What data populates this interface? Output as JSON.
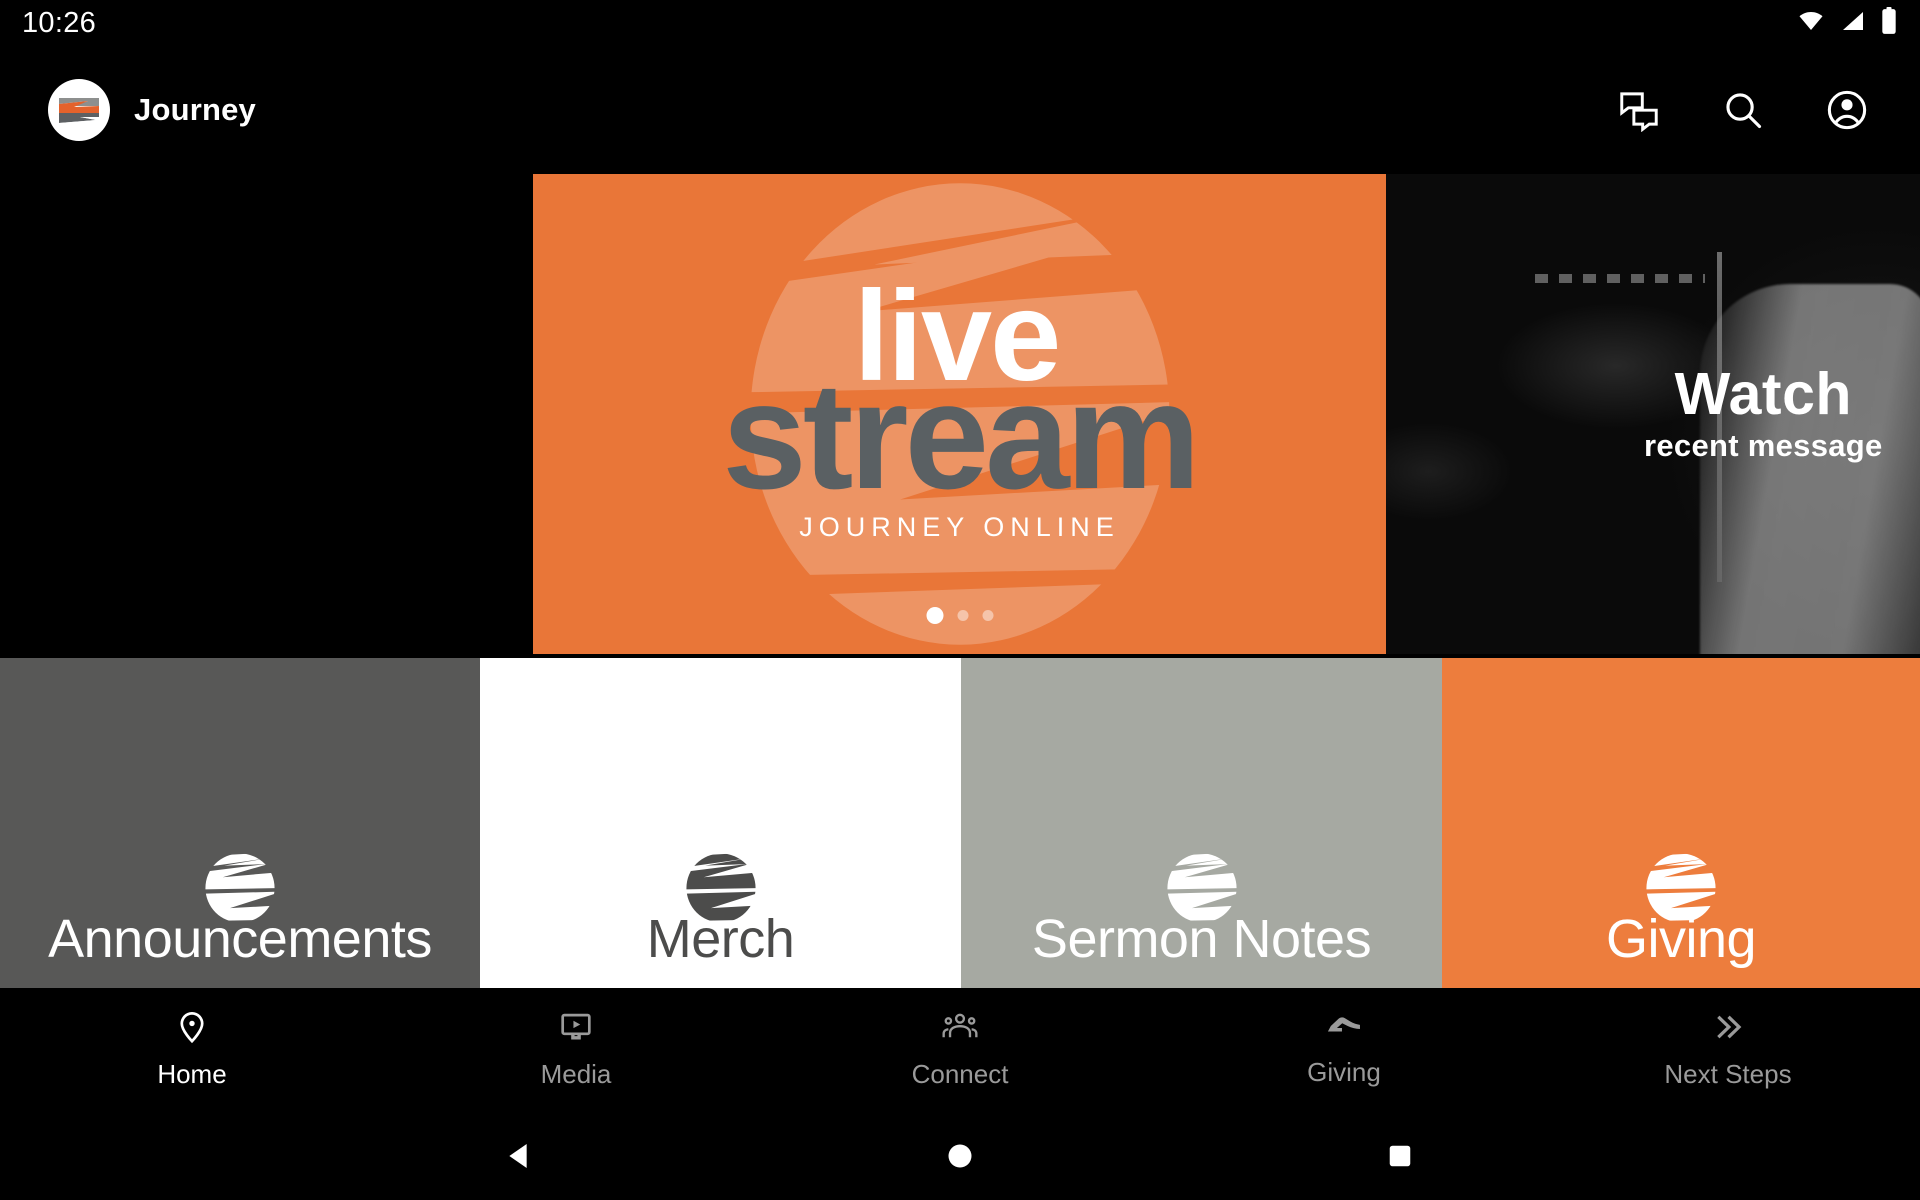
{
  "status_bar": {
    "time": "10:26",
    "icons": [
      "wifi-icon",
      "cellular-signal-icon",
      "battery-icon"
    ]
  },
  "app_bar": {
    "logo_name": "journey-logo",
    "title": "Journey",
    "actions": [
      {
        "name": "chat-icon",
        "label": "Chat"
      },
      {
        "name": "search-icon",
        "label": "Search"
      },
      {
        "name": "account-icon",
        "label": "Account"
      }
    ]
  },
  "hero": {
    "slides": [
      {
        "name": "live-stream-slide",
        "line1": "live",
        "line2": "stream",
        "subtitle": "JOURNEY  ONLINE",
        "bg_color": "#e97638",
        "line1_color": "#ffffff",
        "line2_color": "#5a6063"
      },
      {
        "name": "watch-recent-message-slide",
        "title": "Watch",
        "subtitle": "recent message",
        "bg_color": "#070707"
      }
    ],
    "pagination": {
      "total": 3,
      "active_index": 0
    }
  },
  "tiles": [
    {
      "label": "Announcements",
      "bg_color": "#585857",
      "text_color": "#ffffff",
      "mark_color": "#ffffff",
      "name": "tile-announcements"
    },
    {
      "label": "Merch",
      "bg_color": "#ffffff",
      "text_color": "#4c4c4b",
      "mark_color": "#4c4c4b",
      "name": "tile-merch"
    },
    {
      "label": "Sermon Notes",
      "bg_color": "#a6a9a2",
      "text_color": "#ffffff",
      "mark_color": "#ffffff",
      "name": "tile-sermon-notes"
    },
    {
      "label": "Giving",
      "bg_color": "#ed7d3d",
      "text_color": "#ffffff",
      "mark_color": "#ffffff",
      "name": "tile-giving"
    }
  ],
  "bottom_nav": {
    "active_index": 0,
    "active_color": "#ffffff",
    "inactive_color": "#9a9a9a",
    "items": [
      {
        "label": "Home",
        "icon": "location-pin-icon"
      },
      {
        "label": "Media",
        "icon": "tv-play-icon"
      },
      {
        "label": "Connect",
        "icon": "people-group-icon"
      },
      {
        "label": "Giving",
        "icon": "open-hand-icon"
      },
      {
        "label": "Next Steps",
        "icon": "double-chevron-right-icon"
      }
    ]
  },
  "system_nav": {
    "buttons": [
      {
        "name": "back-button",
        "icon": "triangle-left-icon"
      },
      {
        "name": "home-button",
        "icon": "circle-icon"
      },
      {
        "name": "recents-button",
        "icon": "square-icon"
      }
    ]
  }
}
